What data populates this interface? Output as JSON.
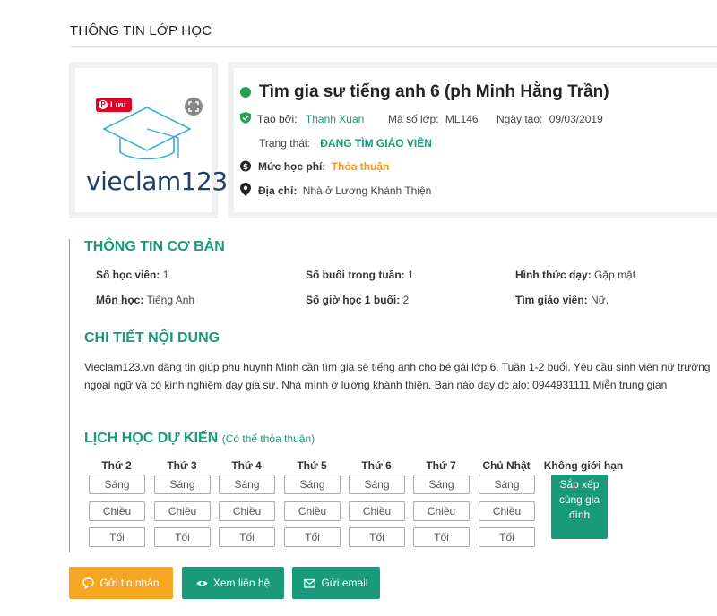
{
  "section_title": "THÔNG TIN LỚP HỌC",
  "logo": {
    "pin_label": "Lưu",
    "brand": "vieclam123"
  },
  "job": {
    "title": "Tìm gia sư tiếng anh 6 (ph Minh Hằng Trần)",
    "created_by_label": "Tạo bởi:",
    "created_by": "Thanh Xuan",
    "class_code_label": "Mã số lớp:",
    "class_code": "ML146",
    "created_date_label": "Ngày tạo:",
    "created_date": "09/03/2019",
    "status_label": "Trạng thái:",
    "status": "ĐANG TÌM GIÁO VIÊN",
    "fee_label": "Mức học phí:",
    "fee": "Thỏa thuận",
    "address_label": "Địa chỉ:",
    "address": "Nhà ở Lương Khánh Thiện"
  },
  "basic": {
    "heading": "THÔNG TIN CƠ BẢN",
    "students_label": "Số học viên:",
    "students": "1",
    "sessions_label": "Số buổi trong tuần:",
    "sessions": "1",
    "mode_label": "Hình thức dạy:",
    "mode": "Gặp mặt",
    "subject_label": "Môn học:",
    "subject": "Tiếng Anh",
    "hours_label": "Số giờ học 1 buổi:",
    "hours": "2",
    "teacher_label": "Tìm giáo viên:",
    "teacher": "Nữ,"
  },
  "detail": {
    "heading": "CHI TIẾT NỘI DUNG",
    "text": "Vieclam123.vn đăng tin giúp phụ huynh Minh cần tìm gia sẽ tiếng anh cho bé gái lớp 6. Tuần 1-2 buổi. Yêu cầu sinh viên nữ trường ngoại ngữ và có kinh nghiệm dạy gia sư. Nhà mình ở lương khánh thiện. Bạn nào dạy dc alo: 0944931111 Miễn trung gian"
  },
  "schedule": {
    "heading": "LỊCH HỌC DỰ KIẾN",
    "note": "(Có thể thỏa thuận)",
    "days": [
      "Thứ 2",
      "Thứ 3",
      "Thứ 4",
      "Thứ 5",
      "Thứ 6",
      "Thứ 7",
      "Chủ Nhật"
    ],
    "slots": [
      "Sáng",
      "Chiều",
      "Tối"
    ],
    "no_limit": "Không giới hạn",
    "arrange": "Sắp xếp cùng gia đình"
  },
  "buttons": {
    "message": "Gửi tin nhắn",
    "contact": "Xem liên hệ",
    "email": "Gửi email"
  },
  "colors": {
    "accent": "#199a7b",
    "orange": "#f5a623",
    "status_dot": "#22a353"
  }
}
